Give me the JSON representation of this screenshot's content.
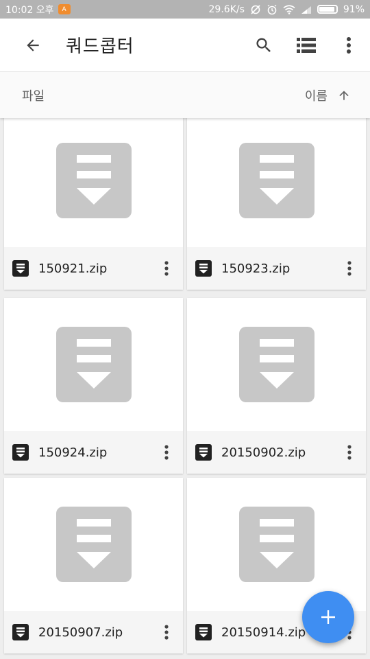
{
  "status_bar": {
    "time": "10:02 오후",
    "app_icon_label": "A",
    "net_speed": "29.6K/s",
    "battery": "91%",
    "battery_level": 0.91
  },
  "toolbar": {
    "title": "쿼드콥터",
    "back_icon": "arrow-left-icon",
    "search_icon": "search-icon",
    "view_icon": "list-view-icon",
    "more_icon": "more-vert-icon"
  },
  "sort_bar": {
    "left_label": "파일",
    "sort_label": "이름",
    "sort_icon": "arrow-up-icon"
  },
  "files": [
    {
      "name": "150921.zip"
    },
    {
      "name": "150923.zip"
    },
    {
      "name": "150924.zip"
    },
    {
      "name": "20150902.zip"
    },
    {
      "name": "20150907.zip"
    },
    {
      "name": "20150914.zip"
    }
  ],
  "fab": {
    "icon": "plus-icon"
  },
  "colors": {
    "accent": "#3f8ef2",
    "status_bar": "#b3b3b3",
    "thumbnail": "#c7c7c7"
  }
}
